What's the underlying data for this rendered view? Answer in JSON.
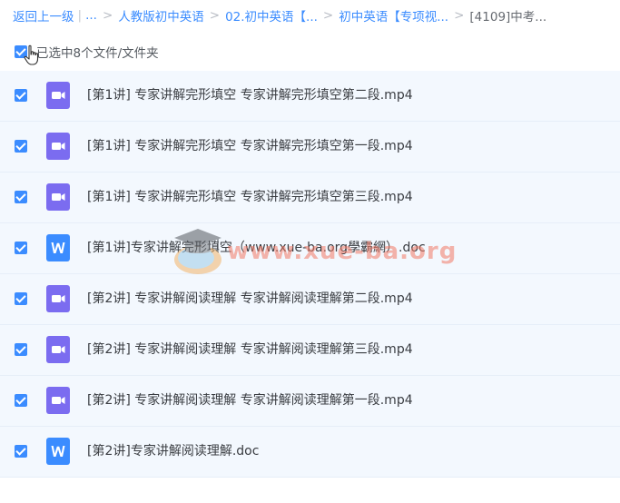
{
  "breadcrumb": {
    "back": "返回上一级",
    "more": "...",
    "items": [
      "人教版初中英语",
      "02.初中英语【...",
      "初中英语【专项视...",
      "[4109]中考..."
    ]
  },
  "selection": {
    "label": "已选中8个文件/文件夹"
  },
  "files": [
    {
      "name": "[第1讲] 专家讲解完形填空 专家讲解完形填空第二段.mp4",
      "type": "video-icon"
    },
    {
      "name": "[第1讲] 专家讲解完形填空 专家讲解完形填空第一段.mp4",
      "type": "video-icon"
    },
    {
      "name": "[第1讲] 专家讲解完形填空 专家讲解完形填空第三段.mp4",
      "type": "video-icon"
    },
    {
      "name": "[第1讲]专家讲解完形填空（www.xue-ba.org學霸網）.doc",
      "type": "word-icon"
    },
    {
      "name": "[第2讲] 专家讲解阅读理解 专家讲解阅读理解第二段.mp4",
      "type": "video-icon"
    },
    {
      "name": "[第2讲] 专家讲解阅读理解 专家讲解阅读理解第三段.mp4",
      "type": "video-icon"
    },
    {
      "name": "[第2讲] 专家讲解阅读理解 专家讲解阅读理解第一段.mp4",
      "type": "video-icon"
    },
    {
      "name": "[第2讲]专家讲解阅读理解.doc",
      "type": "word-icon"
    }
  ],
  "watermark": {
    "text": "www.xue-ba.org"
  },
  "colors": {
    "accent": "#3b8cff",
    "video_icon": "#7b6cf0",
    "word_icon": "#3b8cff",
    "row_bg": "#f3f8fe"
  }
}
